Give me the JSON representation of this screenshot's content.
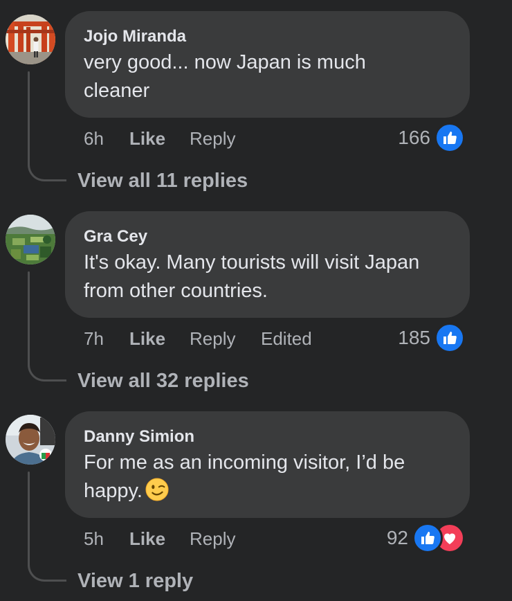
{
  "comments": [
    {
      "author": "Jojo Miranda",
      "text": "very good... now Japan is much cleaner",
      "time": "6h",
      "like_label": "Like",
      "reply_label": "Reply",
      "edited_label": "",
      "reaction_count": "166",
      "reactions": [
        "like"
      ],
      "view_replies": "View all 11 replies",
      "avatar": "torii-gates-photo"
    },
    {
      "author": "Gra Cey",
      "text": "It's okay. Many tourists will visit Japan from other countries.",
      "time": "7h",
      "like_label": "Like",
      "reply_label": "Reply",
      "edited_label": "Edited",
      "reaction_count": "185",
      "reactions": [
        "like"
      ],
      "view_replies": "View all 32 replies",
      "avatar": "garden-landscape-photo"
    },
    {
      "author": "Danny Simion",
      "text": "For me as an incoming visitor, I’d be happy.",
      "emoji": "winking-face",
      "time": "5h",
      "like_label": "Like",
      "reply_label": "Reply",
      "edited_label": "",
      "reaction_count": "92",
      "reactions": [
        "like",
        "love"
      ],
      "view_replies": "View 1 reply",
      "avatar": "person-portrait-photo"
    }
  ],
  "colors": {
    "background": "#242526",
    "bubble": "#3a3b3c",
    "text_primary": "#e4e6eb",
    "text_secondary": "#b0b3b8",
    "like_blue": "#1877f2",
    "love_red": "#f33e58"
  }
}
